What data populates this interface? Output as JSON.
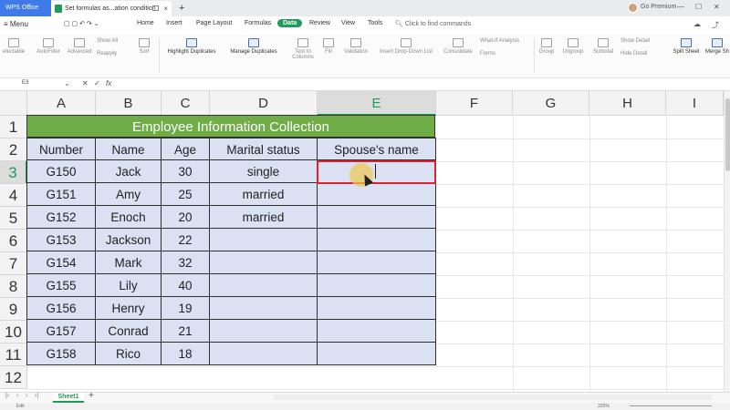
{
  "titlebar": {
    "app_tab": "WPS Office",
    "doc_tab": "Set formulas as...ation condition",
    "premium": "Go Premium"
  },
  "menu": {
    "hamburger_label": "Menu",
    "tabs": [
      "Home",
      "Insert",
      "Page Layout",
      "Formulas",
      "Data",
      "Review",
      "View",
      "Tools"
    ],
    "active_tab": "Data",
    "search_placeholder": "Click to find commands"
  },
  "ribbon": {
    "selectable": "electable",
    "autofilter": "AutoFilter",
    "advanced": "Advanced",
    "show_all": "Show All",
    "reapply": "Reapply",
    "sort": "Sort",
    "highlight_duplicates": "Highlight Duplicates",
    "manage_duplicates": "Manage Duplicates",
    "text_to_columns": "Text to Columns",
    "fill": "Fill",
    "validation": "Validation",
    "insert_dropdown": "Insert Drop-Down List",
    "consolidate": "Consolidate",
    "what_if": "What-If Analysis",
    "forms": "Forms",
    "group": "Group",
    "ungroup": "Ungroup",
    "subtotal": "Subtotal",
    "show_detail": "Show Detail",
    "hide_detail": "Hide Detail",
    "split_sheet": "Split Sheet",
    "merge_sheet": "Merge Sh"
  },
  "formula_bar": {
    "name_box": "E3",
    "fx": "fx"
  },
  "grid": {
    "columns": [
      "A",
      "B",
      "C",
      "D",
      "E",
      "F",
      "G",
      "H",
      "I"
    ],
    "selected_column": "E",
    "rows": [
      "1",
      "2",
      "3",
      "4",
      "5",
      "6",
      "7",
      "8",
      "9",
      "10",
      "11",
      "12"
    ],
    "selected_row": "3",
    "title": "Employee Information Collection",
    "headers": [
      "Number",
      "Name",
      "Age",
      "Marital status",
      "Spouse's name"
    ],
    "data": [
      [
        "G150",
        "Jack",
        "30",
        "single",
        ""
      ],
      [
        "G151",
        "Amy",
        "25",
        "married",
        ""
      ],
      [
        "G152",
        "Enoch",
        "20",
        "married",
        ""
      ],
      [
        "G153",
        "Jackson",
        "22",
        "",
        ""
      ],
      [
        "G154",
        "Mark",
        "32",
        "",
        ""
      ],
      [
        "G155",
        "Lily",
        "40",
        "",
        ""
      ],
      [
        "G156",
        "Henry",
        "19",
        "",
        ""
      ],
      [
        "G157",
        "Conrad",
        "21",
        "",
        ""
      ],
      [
        "G158",
        "Rico",
        "18",
        "",
        ""
      ]
    ]
  },
  "sheets": {
    "active": "Sheet1"
  },
  "status": {
    "mode": "Edit",
    "zoom": "225%"
  },
  "colors": {
    "accent": "#1f9b58",
    "title_fill": "#70ad47",
    "table_fill": "#d9e1f2",
    "active_border": "#e0202a"
  }
}
